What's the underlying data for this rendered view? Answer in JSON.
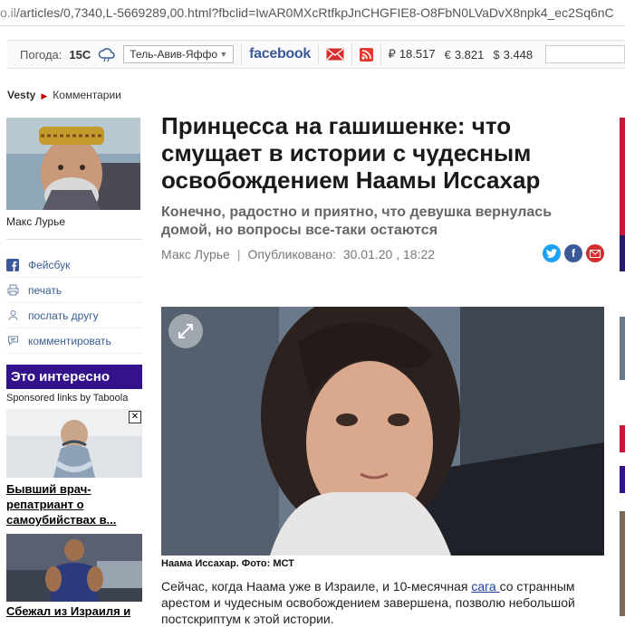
{
  "browser": {
    "url_host": "o.il",
    "url_path": "/articles/0,7340,L-5669289,00.html?fbclid=IwAR0MXcRtfkpJnCHGFIE8-O8FbN0LVaDvX8npk4_ec2Sq6nC"
  },
  "topbar": {
    "weather_label": "Погода:",
    "temperature": "15C",
    "city": "Тель-Авив-Яффо",
    "facebook": "facebook",
    "rates": [
      {
        "symbol": "₽",
        "value": "18.517"
      },
      {
        "symbol": "€",
        "value": "3.821"
      },
      {
        "symbol": "$",
        "value": "3.448"
      }
    ]
  },
  "breadcrumb": {
    "site": "Vesty",
    "section": "Комментарии"
  },
  "sidebar": {
    "author_name": "Макс Лурье",
    "share_items": [
      {
        "label": "Фейсбук",
        "icon": "facebook-icon"
      },
      {
        "label": "печать",
        "icon": "printer-icon"
      },
      {
        "label": "послать другу",
        "icon": "person-icon"
      },
      {
        "label": "комментировать",
        "icon": "comment-icon"
      }
    ],
    "interest_title": "Это интересно",
    "sponsored": "Sponsored links by Taboola",
    "ad1_text": "Бывший врач-репатриант о самоубийствах в...",
    "ad2_text": "Сбежал из Израиля и"
  },
  "article": {
    "headline": "Принцесса на гашишенке: что смущает в истории с чудесным освобождением Наамы Иссахар",
    "subhead": "Конечно, радостно и приятно, что девушка вернулась домой, но вопросы все-таки остаются",
    "author": "Макс Лурье",
    "published_label": "Опубликовано:",
    "published_date": "30.01.20 , 18:22",
    "caption": "Наама Иссахар. Фото: МСТ",
    "body_part1": "Сейчас, когда Наама уже в Израиле, и 10-месячная ",
    "body_link": "сага ",
    "body_part2": "со странным арестом и чудесным освобождением завершена, позволю небольшой постскриптум к этой истории."
  },
  "colors": {
    "accent_purple": "#33128c",
    "facebook_blue": "#3b5998",
    "link": "#1a3fa0",
    "mail_red": "#d32f2f",
    "twitter": "#1da1f2"
  }
}
